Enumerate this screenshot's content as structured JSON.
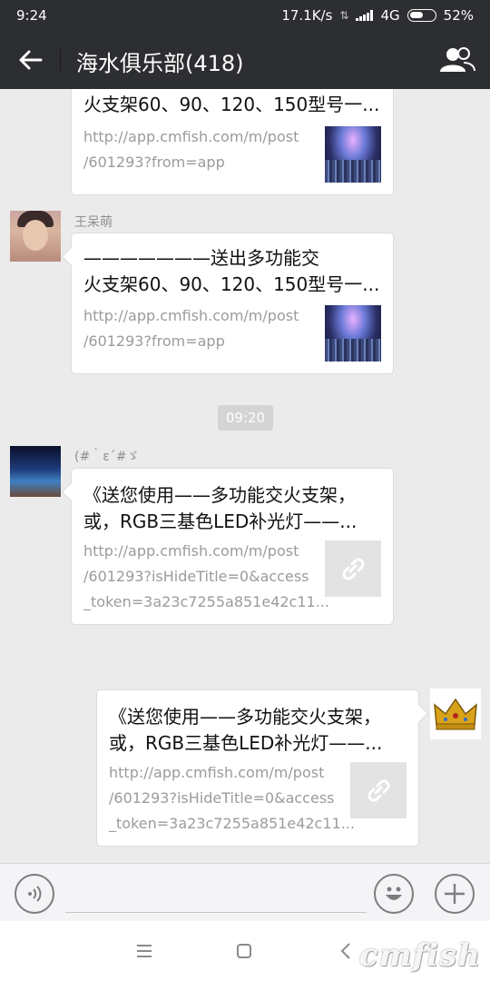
{
  "status_bar": {
    "time": "9:24",
    "net_speed": "17.1K/s",
    "network": "4G",
    "battery": "52%"
  },
  "header": {
    "title": "海水俱乐部(418)",
    "back_icon": "arrow-left-icon",
    "group_icon": "group-members-icon"
  },
  "messages": [
    {
      "title": "火支架60、90、120、150型号一...",
      "url_lines": [
        "http://app.cmfish.com/m/post",
        "/601293?from=app"
      ]
    },
    {
      "sender": "王呆萌",
      "title_lines": [
        "———————送出多功能交",
        "火支架60、90、120、150型号一..."
      ],
      "url_lines": [
        "http://app.cmfish.com/m/post",
        "/601293?from=app"
      ]
    },
    {
      "time": "09:20"
    },
    {
      "sender": "(#｀ε´#ゞ",
      "title_lines": [
        "《送您使用——多功能交火支架，",
        "或，RGB三基色LED补光灯——..."
      ],
      "url_lines": [
        "http://app.cmfish.com/m/post",
        "/601293?isHideTitle=0&access",
        "_token=3a23c7255a851e42c11..."
      ]
    },
    {
      "title_lines": [
        "《送您使用——多功能交火支架，",
        "或，RGB三基色LED补光灯——..."
      ],
      "url_lines": [
        "http://app.cmfish.com/m/post",
        "/601293?isHideTitle=0&access",
        "_token=3a23c7255a851e42c11..."
      ]
    }
  ],
  "input": {
    "value": ""
  },
  "watermark": "cmfish"
}
